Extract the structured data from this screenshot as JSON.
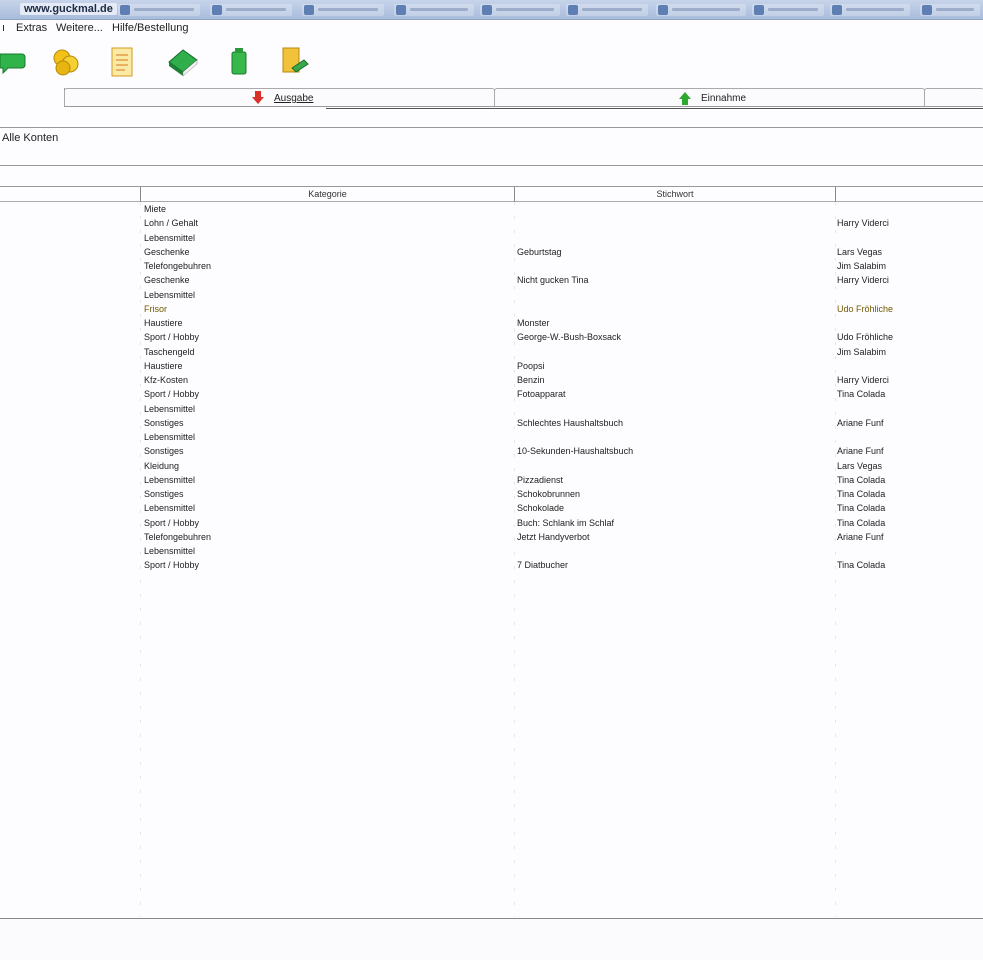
{
  "window": {
    "title": "www.guckmal.de"
  },
  "menu": {
    "items": [
      {
        "key": "edge",
        "label": "ı"
      },
      {
        "key": "extras",
        "label": "Extras"
      },
      {
        "key": "weitere",
        "label": "Weitere..."
      },
      {
        "key": "hilfe",
        "label": "Hilfe/Bestellung"
      }
    ]
  },
  "toolbar": {
    "icons": [
      "speech-bubble-icon",
      "coins-icon",
      "notepad-icon",
      "green-book-icon",
      "green-bag-icon",
      "folder-pen-icon"
    ]
  },
  "tabs": {
    "ausgabe": "Ausgabe",
    "einnahme": "Einnahme"
  },
  "konten": {
    "label": "Alle Konten"
  },
  "table": {
    "columns": {
      "kategorie": "Kategorie",
      "stichwort": "Stichwort",
      "person": ""
    },
    "rows": [
      {
        "kategorie": "Miete",
        "stichwort": "",
        "person": ""
      },
      {
        "kategorie": "Lohn / Gehalt",
        "stichwort": "",
        "person": "Harry Viderci"
      },
      {
        "kategorie": "Lebensmittel",
        "stichwort": "",
        "person": ""
      },
      {
        "kategorie": "Geschenke",
        "stichwort": "Geburtstag",
        "person": "Lars Vegas"
      },
      {
        "kategorie": "Telefongebuhren",
        "stichwort": "",
        "person": "Jim Salabim"
      },
      {
        "kategorie": "Geschenke",
        "stichwort": "Nicht gucken Tina",
        "person": "Harry Viderci"
      },
      {
        "kategorie": "Lebensmittel",
        "stichwort": "",
        "person": ""
      },
      {
        "kategorie": "Frisor",
        "stichwort": "",
        "person": "Udo Fröhliche",
        "highlight": true
      },
      {
        "kategorie": "Haustiere",
        "stichwort": "Monster",
        "person": ""
      },
      {
        "kategorie": "Sport / Hobby",
        "stichwort": "George-W.-Bush-Boxsack",
        "person": "Udo Fröhliche"
      },
      {
        "kategorie": "Taschengeld",
        "stichwort": "",
        "person": "Jim Salabim"
      },
      {
        "kategorie": "Haustiere",
        "stichwort": "Poopsi",
        "person": ""
      },
      {
        "kategorie": "Kfz-Kosten",
        "stichwort": "Benzin",
        "person": "Harry Viderci"
      },
      {
        "kategorie": "Sport / Hobby",
        "stichwort": "Fotoapparat",
        "person": "Tina Colada"
      },
      {
        "kategorie": "Lebensmittel",
        "stichwort": "",
        "person": ""
      },
      {
        "kategorie": "Sonstiges",
        "stichwort": "Schlechtes Haushaltsbuch",
        "person": "Ariane Funf"
      },
      {
        "kategorie": "Lebensmittel",
        "stichwort": "",
        "person": ""
      },
      {
        "kategorie": "Sonstiges",
        "stichwort": "10-Sekunden-Haushaltsbuch",
        "person": "Ariane Funf"
      },
      {
        "kategorie": "Kleidung",
        "stichwort": "",
        "person": "Lars Vegas"
      },
      {
        "kategorie": "Lebensmittel",
        "stichwort": "Pizzadienst",
        "person": "Tina Colada"
      },
      {
        "kategorie": "Sonstiges",
        "stichwort": "Schokobrunnen",
        "person": "Tina Colada"
      },
      {
        "kategorie": "Lebensmittel",
        "stichwort": "Schokolade",
        "person": "Tina Colada"
      },
      {
        "kategorie": "Sport / Hobby",
        "stichwort": "Buch: Schlank im Schlaf",
        "person": "Tina Colada"
      },
      {
        "kategorie": "Telefongebuhren",
        "stichwort": "Jetzt Handyverbot",
        "person": "Ariane Funf"
      },
      {
        "kategorie": "Lebensmittel",
        "stichwort": "",
        "person": ""
      },
      {
        "kategorie": "Sport / Hobby",
        "stichwort": "7 Diatbucher",
        "person": "Tina Colada"
      }
    ]
  },
  "colors": {
    "highlight_text": "#6e5a00",
    "ausgabe_arrow": "#d9302a",
    "einnahme_arrow": "#2ea82e"
  }
}
